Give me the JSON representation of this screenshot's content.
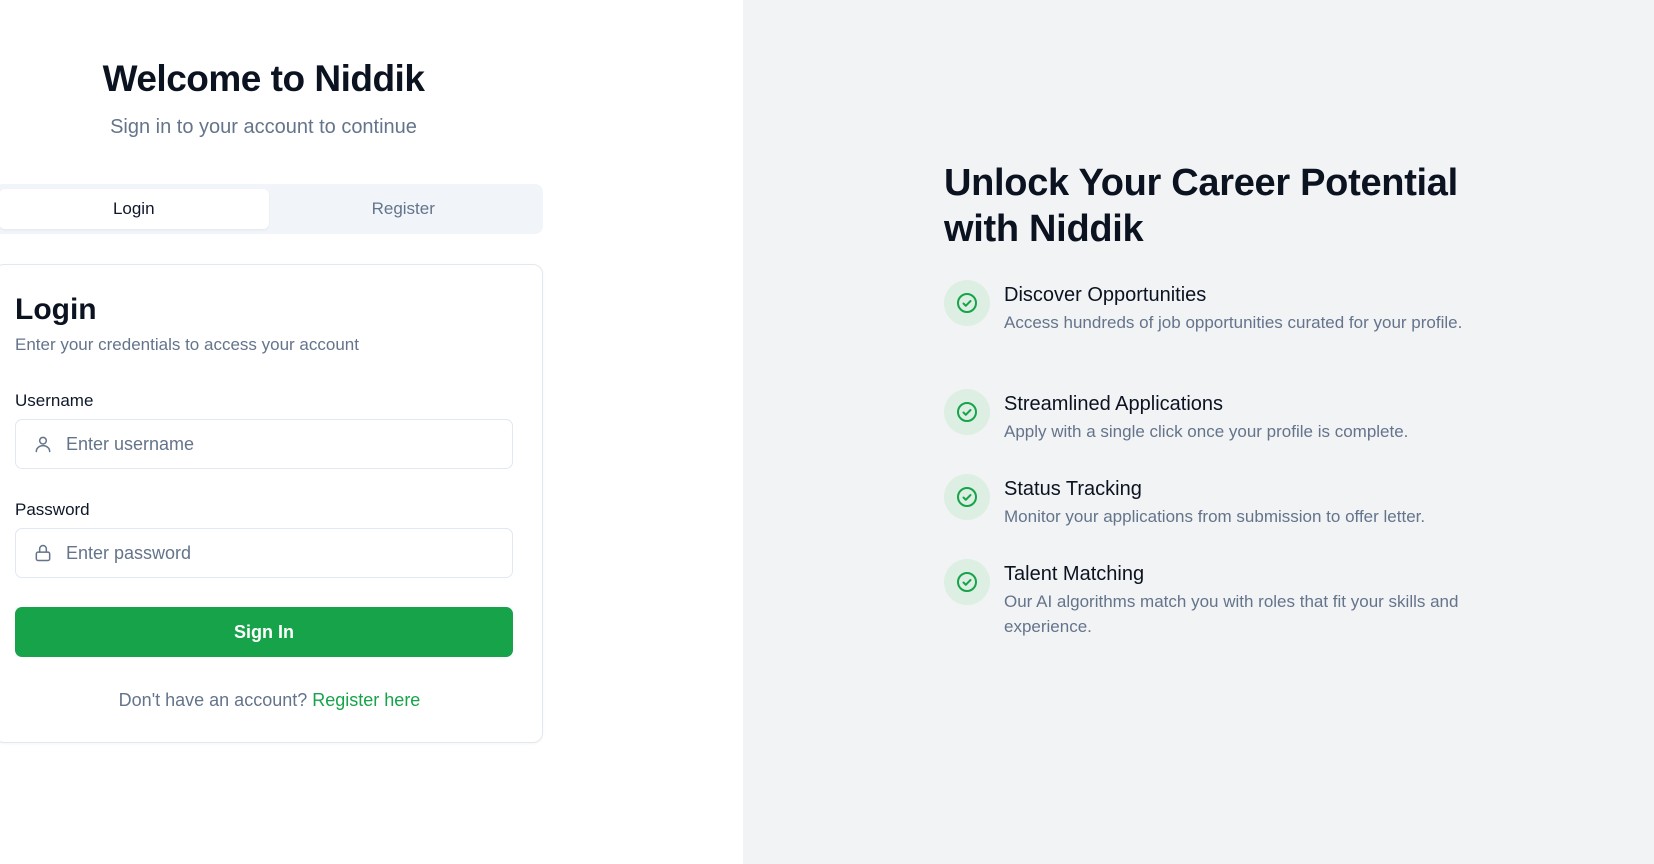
{
  "left": {
    "welcome_title": "Welcome to Niddik",
    "welcome_subtitle": "Sign in to your account to continue",
    "tabs": [
      {
        "label": "Login",
        "active": true
      },
      {
        "label": "Register",
        "active": false
      }
    ],
    "card": {
      "title": "Login",
      "subtitle": "Enter your credentials to access your account",
      "username": {
        "label": "Username",
        "placeholder": "Enter username",
        "value": "",
        "icon": "user-icon"
      },
      "password": {
        "label": "Password",
        "placeholder": "Enter password",
        "value": "",
        "icon": "lock-icon"
      },
      "submit_label": "Sign In",
      "footer_text": "Don't have an account?",
      "footer_link": "Register here"
    }
  },
  "right": {
    "title_line1": "Unlock Your Career Potential",
    "title_line2": "with Niddik",
    "features": [
      {
        "title": "Discover Opportunities",
        "description": "Access hundreds of job opportunities curated for your profile.",
        "icon": "check-circle-icon"
      },
      {
        "title": "Streamlined Applications",
        "description": "Apply with a single click once your profile is complete.",
        "icon": "check-circle-icon"
      },
      {
        "title": "Status Tracking",
        "description": "Monitor your applications from submission to offer letter.",
        "icon": "check-circle-icon"
      },
      {
        "title": "Talent Matching",
        "description": "Our AI algorithms match you with roles that fit your skills and experience.",
        "icon": "check-circle-icon"
      }
    ]
  },
  "colors": {
    "accent": "#16a34a",
    "muted_text": "#64748b",
    "right_panel_bg": "#f2f3f5",
    "check_bg": "#dcefe2"
  }
}
